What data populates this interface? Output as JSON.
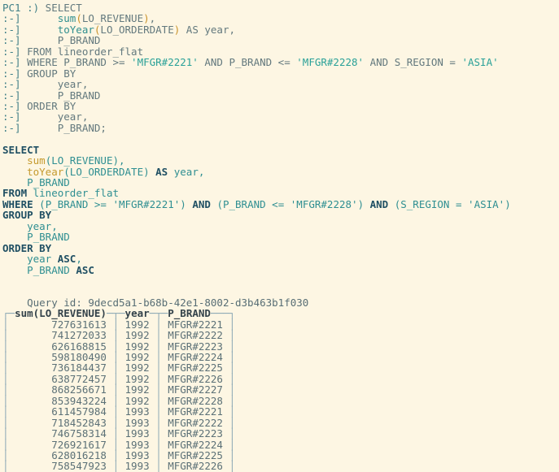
{
  "terminal": {
    "prompt_first": "PC1 :)",
    "prompt_cont": ":-]",
    "input_lines": [
      {
        "prompt": "PC1 :)",
        "tokens": [
          {
            "t": " SELECT",
            "c": "kw"
          }
        ]
      },
      {
        "prompt": ":-]",
        "tokens": [
          {
            "t": "      ",
            "c": "plain"
          },
          {
            "t": "sum",
            "c": "fn"
          },
          {
            "t": "(",
            "c": "paren"
          },
          {
            "t": "LO_REVENUE",
            "c": "plain"
          },
          {
            "t": ")",
            "c": "paren"
          },
          {
            "t": ",",
            "c": "plain"
          }
        ]
      },
      {
        "prompt": ":-]",
        "tokens": [
          {
            "t": "      ",
            "c": "plain"
          },
          {
            "t": "toYear",
            "c": "fn"
          },
          {
            "t": "(",
            "c": "paren"
          },
          {
            "t": "LO_ORDERDATE",
            "c": "plain"
          },
          {
            "t": ")",
            "c": "paren"
          },
          {
            "t": " AS year,",
            "c": "plain"
          }
        ]
      },
      {
        "prompt": ":-]",
        "tokens": [
          {
            "t": "      P_BRAND",
            "c": "plain"
          }
        ]
      },
      {
        "prompt": ":-]",
        "tokens": [
          {
            "t": " FROM lineorder_flat",
            "c": "plain"
          }
        ]
      },
      {
        "prompt": ":-]",
        "tokens": [
          {
            "t": " WHERE P_BRAND >= ",
            "c": "plain"
          },
          {
            "t": "'MFGR#2221'",
            "c": "str"
          },
          {
            "t": " AND P_BRAND <= ",
            "c": "plain"
          },
          {
            "t": "'MFGR#2228'",
            "c": "str"
          },
          {
            "t": " AND S_REGION = ",
            "c": "plain"
          },
          {
            "t": "'ASIA'",
            "c": "str"
          }
        ]
      },
      {
        "prompt": ":-]",
        "tokens": [
          {
            "t": " GROUP BY",
            "c": "plain"
          }
        ]
      },
      {
        "prompt": ":-]",
        "tokens": [
          {
            "t": "      year,",
            "c": "plain"
          }
        ]
      },
      {
        "prompt": ":-]",
        "tokens": [
          {
            "t": "      P_BRAND",
            "c": "plain"
          }
        ]
      },
      {
        "prompt": ":-]",
        "tokens": [
          {
            "t": " ORDER BY",
            "c": "plain"
          }
        ]
      },
      {
        "prompt": ":-]",
        "tokens": [
          {
            "t": "      year,",
            "c": "plain"
          }
        ]
      },
      {
        "prompt": ":-]",
        "tokens": [
          {
            "t": "      P_BRAND;",
            "c": "plain"
          }
        ]
      }
    ],
    "formatted_query_lines": [
      [
        {
          "t": "SELECT",
          "c": "q-kw"
        }
      ],
      [
        {
          "t": "    ",
          "c": "q-id"
        },
        {
          "t": "sum",
          "c": "q-fn"
        },
        {
          "t": "(LO_REVENUE),",
          "c": "q-id"
        }
      ],
      [
        {
          "t": "    ",
          "c": "q-id"
        },
        {
          "t": "toYear",
          "c": "q-fn"
        },
        {
          "t": "(LO_ORDERDATE) ",
          "c": "q-id"
        },
        {
          "t": "AS",
          "c": "q-kw"
        },
        {
          "t": " year,",
          "c": "q-id"
        }
      ],
      [
        {
          "t": "    P_BRAND",
          "c": "q-id"
        }
      ],
      [
        {
          "t": "FROM",
          "c": "q-kw"
        },
        {
          "t": " lineorder_flat",
          "c": "q-id"
        }
      ],
      [
        {
          "t": "WHERE",
          "c": "q-kw"
        },
        {
          "t": " (P_BRAND >= ",
          "c": "q-id"
        },
        {
          "t": "'MFGR#2221'",
          "c": "q-str"
        },
        {
          "t": ") ",
          "c": "q-id"
        },
        {
          "t": "AND",
          "c": "q-kw"
        },
        {
          "t": " (P_BRAND <= ",
          "c": "q-id"
        },
        {
          "t": "'MFGR#2228'",
          "c": "q-str"
        },
        {
          "t": ") ",
          "c": "q-id"
        },
        {
          "t": "AND",
          "c": "q-kw"
        },
        {
          "t": " (S_REGION = ",
          "c": "q-id"
        },
        {
          "t": "'ASIA'",
          "c": "q-str"
        },
        {
          "t": ")",
          "c": "q-id"
        }
      ],
      [
        {
          "t": "GROUP BY",
          "c": "q-kw"
        }
      ],
      [
        {
          "t": "    year,",
          "c": "q-id"
        }
      ],
      [
        {
          "t": "    P_BRAND",
          "c": "q-id"
        }
      ],
      [
        {
          "t": "ORDER BY",
          "c": "q-kw"
        }
      ],
      [
        {
          "t": "    year ",
          "c": "q-id"
        },
        {
          "t": "ASC",
          "c": "q-kw"
        },
        {
          "t": ",",
          "c": "q-id"
        }
      ],
      [
        {
          "t": "    P_BRAND ",
          "c": "q-id"
        },
        {
          "t": "ASC",
          "c": "q-kw"
        }
      ]
    ],
    "query_id_label": "Query id: ",
    "query_id": "9decd5a1-b68b-42e1-8002-d3b463b1f030"
  },
  "result_table": {
    "columns": [
      "sum(LO_REVENUE)",
      "year",
      "P_BRAND"
    ],
    "rows": [
      [
        "727631613",
        "1992",
        "MFGR#2221"
      ],
      [
        "741272033",
        "1992",
        "MFGR#2222"
      ],
      [
        "626168815",
        "1992",
        "MFGR#2223"
      ],
      [
        "598180490",
        "1992",
        "MFGR#2224"
      ],
      [
        "736184437",
        "1992",
        "MFGR#2225"
      ],
      [
        "638772457",
        "1992",
        "MFGR#2226"
      ],
      [
        "868256671",
        "1992",
        "MFGR#2227"
      ],
      [
        "853943224",
        "1992",
        "MFGR#2228"
      ],
      [
        "611457984",
        "1993",
        "MFGR#2221"
      ],
      [
        "718452843",
        "1993",
        "MFGR#2222"
      ],
      [
        "746758314",
        "1993",
        "MFGR#2223"
      ],
      [
        "726921617",
        "1993",
        "MFGR#2224"
      ],
      [
        "628016218",
        "1993",
        "MFGR#2225"
      ],
      [
        "758547923",
        "1993",
        "MFGR#2226"
      ]
    ]
  },
  "colors": {
    "background": "#fdf6e3",
    "border": "#8aa7b4",
    "string": "#2aa198",
    "keyword": "#1f4f63",
    "function": "#c59a2e",
    "identifier": "#2f8f92",
    "text": "#586e75"
  }
}
